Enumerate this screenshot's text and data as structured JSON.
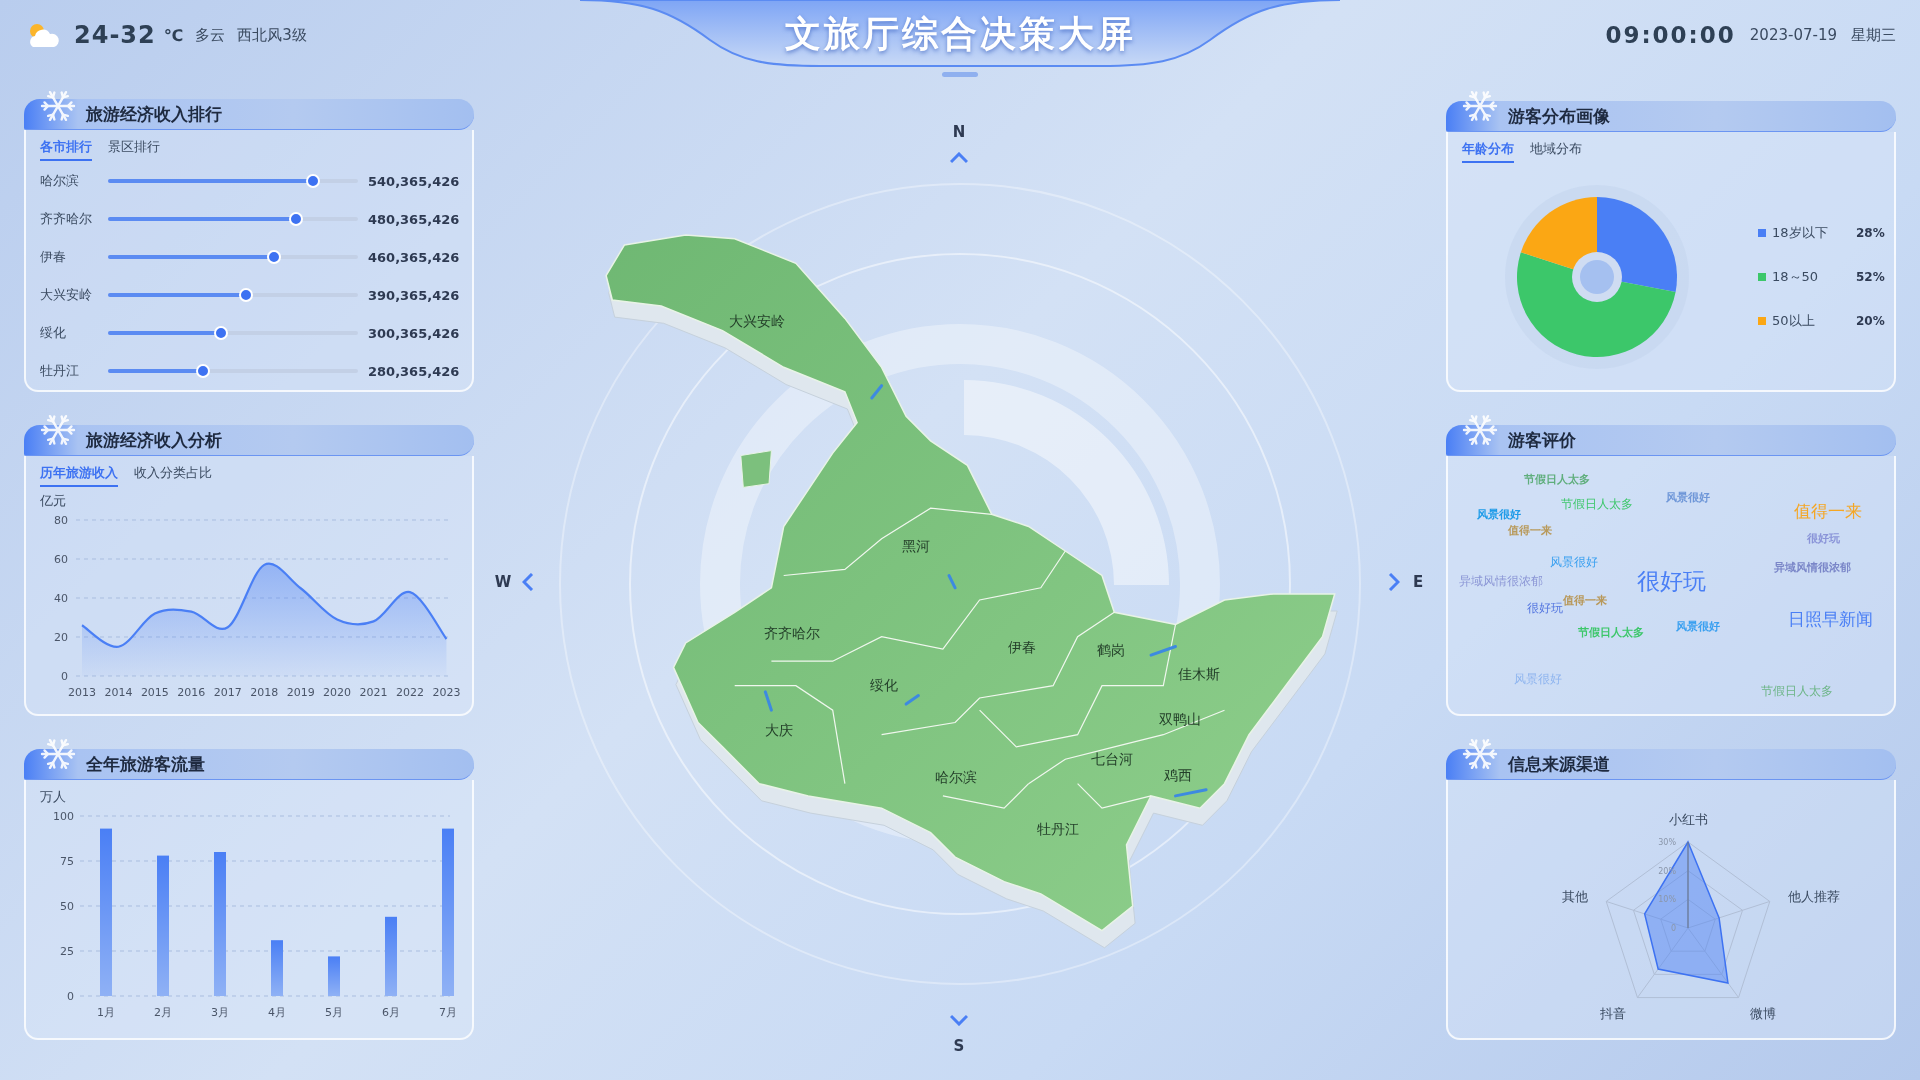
{
  "header": {
    "weather": {
      "temperature": "24-32",
      "unit": "℃",
      "condition": "多云",
      "wind": "西北风3级"
    },
    "title": "文旅厅综合决策大屏",
    "time": "09:00:00",
    "date": "2023-07-19",
    "weekday": "星期三"
  },
  "income_ranking": {
    "title": "旅游经济收入排行",
    "tabs": [
      {
        "label": "各市排行",
        "selected": true
      },
      {
        "label": "景区排行",
        "selected": false
      }
    ],
    "rows": [
      {
        "name": "哈尔滨",
        "value": "540,365,426",
        "level": 0.82
      },
      {
        "name": "齐齐哈尔",
        "value": "480,365,426",
        "level": 0.75
      },
      {
        "name": "伊春",
        "value": "460,365,426",
        "level": 0.665
      },
      {
        "name": "大兴安岭",
        "value": "390,365,426",
        "level": 0.55
      },
      {
        "name": "绥化",
        "value": "300,365,426",
        "level": 0.45
      },
      {
        "name": "牡丹江",
        "value": "280,365,426",
        "level": 0.38
      }
    ]
  },
  "income_analysis": {
    "title": "旅游经济收入分析",
    "tabs": [
      {
        "label": "历年旅游收入",
        "selected": true
      },
      {
        "label": "收入分类占比",
        "selected": false
      }
    ],
    "chart_data": {
      "type": "area",
      "ylabel": "亿元",
      "categories": [
        "2013",
        "2014",
        "2015",
        "2016",
        "2017",
        "2018",
        "2019",
        "2020",
        "2021",
        "2022",
        "2023"
      ],
      "series": [
        {
          "color": "#4a7ff5",
          "values": [
            26,
            15,
            32,
            33,
            25,
            57,
            45,
            29,
            28,
            43,
            19
          ]
        }
      ],
      "ylim": [
        0,
        80
      ],
      "yticks": [
        0,
        20,
        40,
        60,
        80
      ],
      "grid": true
    }
  },
  "visitor_flow": {
    "title": "全年旅游客流量",
    "chart_data": {
      "type": "bar",
      "ylabel": "万人",
      "categories": [
        "1月",
        "2月",
        "3月",
        "4月",
        "5月",
        "6月",
        "7月"
      ],
      "series": [
        {
          "color": "#4a7ff5",
          "values": [
            93,
            78,
            80,
            31,
            22,
            44,
            93
          ]
        }
      ],
      "ylim": [
        0,
        100
      ],
      "yticks": [
        0,
        25,
        50,
        75,
        100
      ],
      "grid": true
    }
  },
  "map": {
    "compass": [
      {
        "label": "N",
        "kind": "north"
      },
      {
        "label": "W",
        "kind": "west"
      },
      {
        "label": "E",
        "kind": "east"
      },
      {
        "label": "S",
        "kind": "south"
      }
    ],
    "regions": [
      {
        "name": "大兴安岭"
      },
      {
        "name": "黑河"
      },
      {
        "name": "齐齐哈尔"
      },
      {
        "name": "伊春"
      },
      {
        "name": "鹤岗"
      },
      {
        "name": "佳木斯"
      },
      {
        "name": "绥化"
      },
      {
        "name": "双鸭山"
      },
      {
        "name": "大庆"
      },
      {
        "name": "七台河"
      },
      {
        "name": "哈尔滨"
      },
      {
        "name": "鸡西"
      },
      {
        "name": "牡丹江"
      }
    ]
  },
  "visitor_profile": {
    "title": "游客分布画像",
    "tabs": [
      {
        "label": "年龄分布",
        "selected": true
      },
      {
        "label": "地域分布",
        "selected": false
      }
    ],
    "chart_data": {
      "type": "donut",
      "categories": [
        "18岁以下",
        "18～50",
        "50以上"
      ],
      "values": [
        28,
        52,
        20
      ]
    },
    "legend": [
      {
        "percent": "28%",
        "color": "#4a7ff5"
      },
      {
        "percent": "52%",
        "color": "#3cc76a"
      },
      {
        "percent": "20%",
        "color": "#fba714"
      }
    ]
  },
  "visitor_reviews": {
    "title": "游客评价",
    "words": [
      {
        "text": "节假日人太多",
        "kind": "xs",
        "color": "#5fae7c"
      },
      {
        "text": "节假日人太多",
        "kind": "m",
        "color": "#3cc76a"
      },
      {
        "text": "风景很好",
        "kind": "s",
        "color": "#6f97d8"
      },
      {
        "text": "风景很好",
        "kind": "s",
        "color": "#1e9be8"
      },
      {
        "text": "值得一来",
        "kind": "s",
        "color": "#b89a5c"
      },
      {
        "text": "值得一来",
        "kind": "l",
        "color": "#f5a623"
      },
      {
        "text": "很好玩",
        "kind": "xs",
        "color": "#8a94d8"
      },
      {
        "text": "风景很好",
        "kind": "m",
        "color": "#3aa0f0"
      },
      {
        "text": "异域风情很浓郁",
        "kind": "xs",
        "color": "#7a86c8"
      },
      {
        "text": "异域风情很浓郁",
        "kind": "m",
        "color": "#8c97d6"
      },
      {
        "text": "很好玩",
        "kind": "xl",
        "color": "#4a7ff5"
      },
      {
        "text": "值得一来",
        "kind": "xs",
        "color": "#b8985a"
      },
      {
        "text": "很好玩",
        "kind": "m",
        "color": "#5577e0"
      },
      {
        "text": "节假日人太多",
        "kind": "xs",
        "color": "#3cc76a"
      },
      {
        "text": "风景很好",
        "kind": "s",
        "color": "#3aa0f0"
      },
      {
        "text": "日照早新闻",
        "kind": "l",
        "color": "#4a7ff5"
      },
      {
        "text": "风景很好",
        "kind": "m",
        "color": "#8fb5ef"
      },
      {
        "text": "节假日人太多",
        "kind": "m",
        "color": "#6cb586"
      }
    ]
  },
  "info_sources": {
    "title": "信息来源渠道",
    "radar": {
      "ticks": [
        "30%",
        "20%",
        "10%",
        "0"
      ],
      "axes": [
        {
          "label": "小红书"
        },
        {
          "label": "他人推荐"
        },
        {
          "label": "微博"
        },
        {
          "label": "抖音"
        },
        {
          "label": "其他"
        }
      ]
    }
  }
}
